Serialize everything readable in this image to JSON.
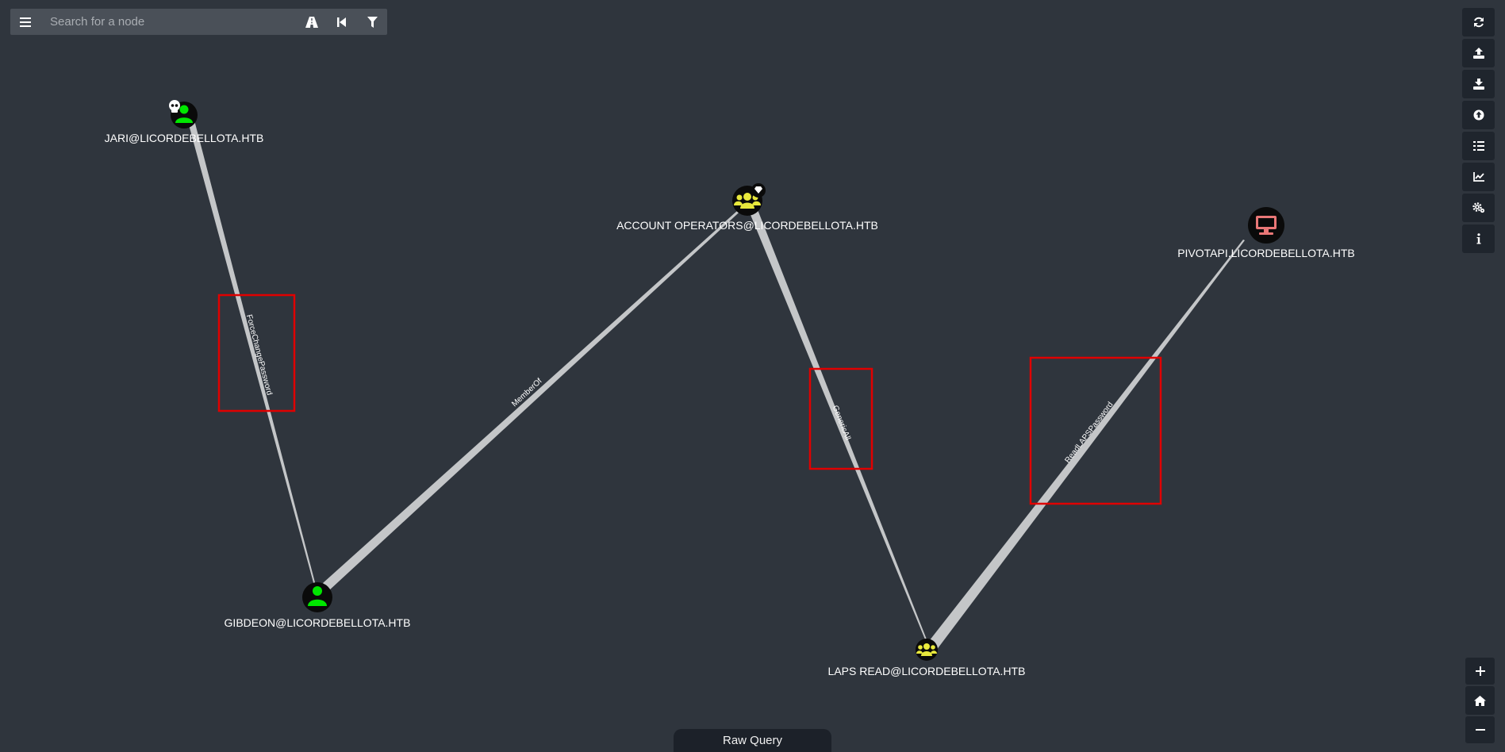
{
  "search": {
    "placeholder": "Search for a node"
  },
  "toolbar": {
    "menu_icon": "hamburger-menu-icon",
    "tools": [
      "pathfinding-icon",
      "back-icon",
      "filter-icon"
    ]
  },
  "right_toolbar": [
    "refresh-icon",
    "upload-icon",
    "download-icon",
    "import-icon",
    "queries-list-icon",
    "chart-icon",
    "settings-icon",
    "info-icon"
  ],
  "zoom": {
    "in_icon": "plus-icon",
    "home_icon": "home-icon",
    "out_icon": "minus-icon"
  },
  "raw_query": {
    "label": "Raw Query"
  },
  "graph": {
    "nodes": {
      "jari": {
        "label": "JARI@LICORDEBELLOTA.HTB",
        "type": "user",
        "color": "#00e600",
        "badge": "skull"
      },
      "gibdeon": {
        "label": "GIBDEON@LICORDEBELLOTA.HTB",
        "type": "user",
        "color": "#00e600"
      },
      "account_operators": {
        "label": "ACCOUNT OPERATORS@LICORDEBELLOTA.HTB",
        "type": "group",
        "color": "#e8e83c",
        "badge": "gem"
      },
      "laps_read": {
        "label": "LAPS READ@LICORDEBELLOTA.HTB",
        "type": "group",
        "color": "#e8e83c"
      },
      "pivotapi": {
        "label": "PIVOTAPI.LICORDEBELLOTA.HTB",
        "type": "computer",
        "color": "#e97777"
      }
    },
    "edges": {
      "e1": {
        "label": "ForceChangePassword",
        "from": "jari",
        "to": "gibdeon"
      },
      "e2": {
        "label": "MemberOf",
        "from": "gibdeon",
        "to": "account_operators"
      },
      "e3": {
        "label": "GenericAll",
        "from": "account_operators",
        "to": "laps_read"
      },
      "e4": {
        "label": "ReadLAPSPassword",
        "from": "laps_read",
        "to": "pivotapi"
      }
    },
    "colors": {
      "background": "#2f353d",
      "edge": "#c4c6c8",
      "highlight_box": "#e00000",
      "node_bg": "#0a0a0a"
    }
  }
}
